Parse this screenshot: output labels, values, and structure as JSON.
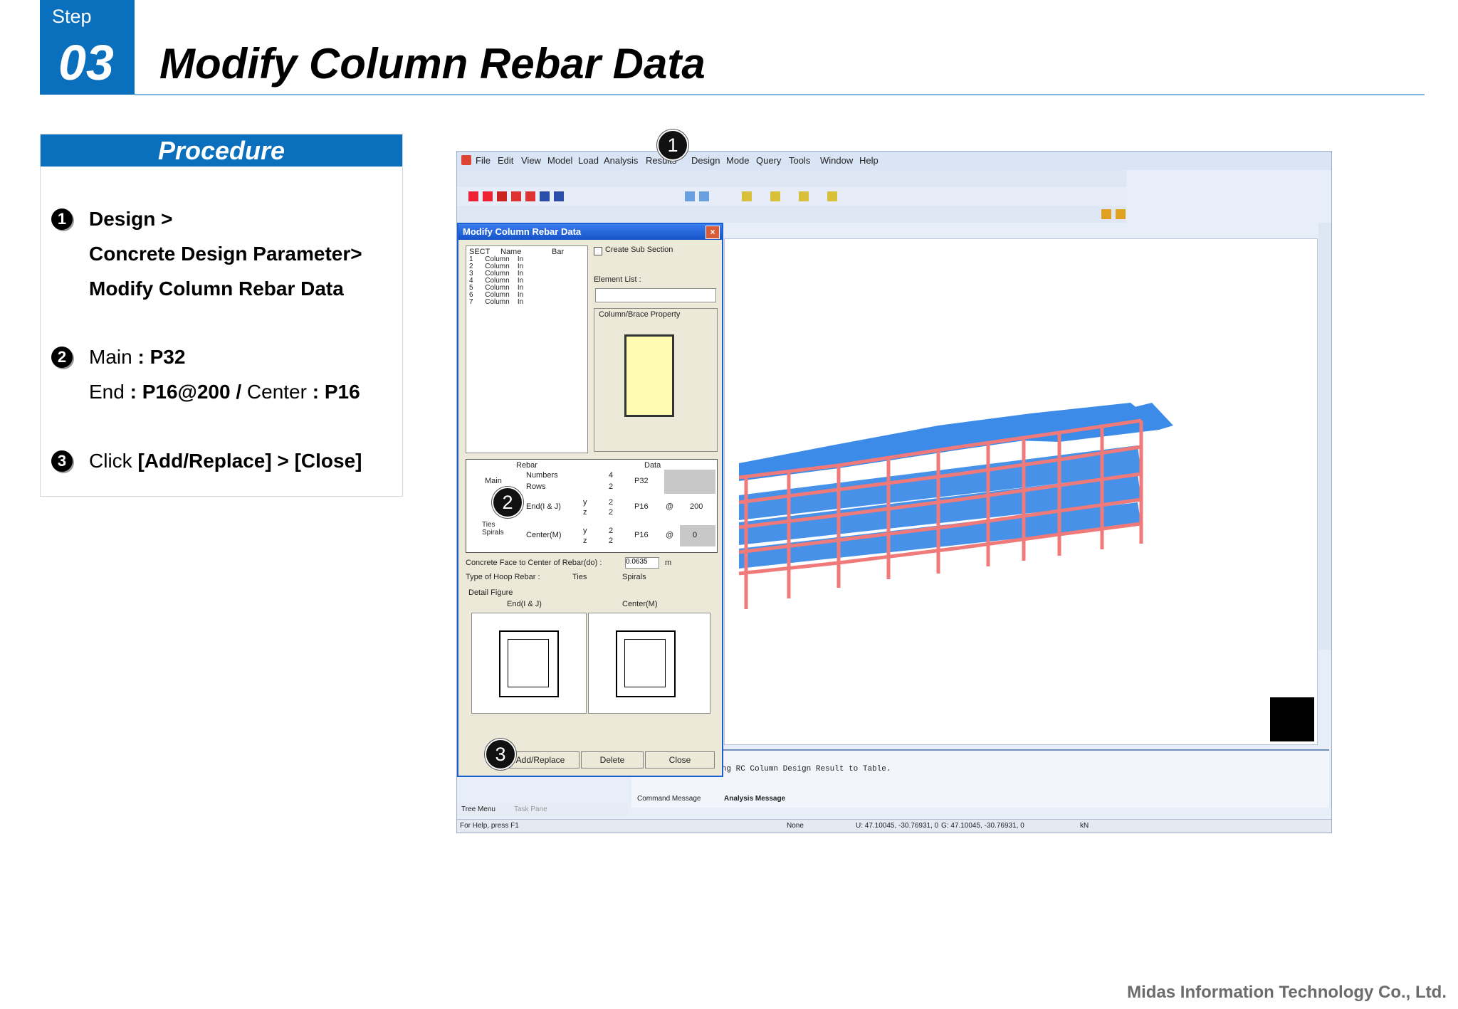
{
  "header": {
    "step_label": "Step",
    "step_number": "03",
    "title": "Modify Column Rebar Data"
  },
  "procedure": {
    "heading": "Procedure",
    "steps": [
      {
        "number": "1",
        "lines": [
          "Design >",
          "Concrete Design Parameter>",
          "Modify Column Rebar Data"
        ]
      },
      {
        "number": "2",
        "main_label": "Main",
        "main_value": ": P32",
        "end_label": "End",
        "end_value": ": P16@200",
        "sep": " / ",
        "center_label": "Center",
        "center_value": ": P16"
      },
      {
        "number": "3",
        "prefix": "Click ",
        "action": "[Add/Replace] > [Close]"
      }
    ]
  },
  "screenshot": {
    "menu": [
      "File",
      "Edit",
      "View",
      "Model",
      "Load",
      "Analysis",
      "Results",
      "Design",
      "Mode",
      "Query",
      "Tools",
      "Window",
      "Help"
    ],
    "dialog": {
      "title": "Modify Column Rebar Data",
      "close_glyph": "×",
      "list_headers": [
        "SECT",
        "Name",
        "Bar"
      ],
      "list_rows": [
        [
          "1",
          "Column",
          "In"
        ],
        [
          "2",
          "Column",
          "In"
        ],
        [
          "3",
          "Column",
          "In"
        ],
        [
          "4",
          "Column",
          "In"
        ],
        [
          "5",
          "Column",
          "In"
        ],
        [
          "6",
          "Column",
          "In"
        ],
        [
          "7",
          "Column",
          "In"
        ]
      ],
      "create_sub_section": "Create Sub Section",
      "element_list": "Element List :",
      "property_group": "Column/Brace Property",
      "table_header_rebar": "Rebar",
      "table_header_data": "Data",
      "main": "Main",
      "numbers": "Numbers",
      "numbers_value": "4",
      "rows": "Rows",
      "rows_value": "2",
      "main_bar": "P32",
      "ties_spirals": "Ties Spirals",
      "ends": "End(I & J)",
      "center": "Center(M)",
      "axis_y": "y",
      "axis_z": "z",
      "end_bar": "P16",
      "at": "@",
      "end_spacing": "200",
      "center_bar": "P16",
      "center_spacing": "0",
      "two": "2",
      "concrete_face": "Concrete Face to Center of Rebar(do) :",
      "concrete_face_value": "0.0635",
      "concrete_face_unit": "m",
      "hoop_type": "Type of Hoop Rebar :",
      "ties": "Ties",
      "spirals": "Spirals",
      "detail_figure": "Detail Figure",
      "fig_end": "End(I & J)",
      "fig_center": "Center(M)",
      "add_replace": "Add/Replace",
      "delete": "Delete",
      "close": "Close"
    },
    "message_line": "*** Finished Writing RC Column Design Result to Table.",
    "tabs": [
      "Tree Menu",
      "Task Pane",
      "Command Message",
      "Analysis Message"
    ],
    "status_help": "For Help, press F1",
    "status_none": "None",
    "status_coord": "U: 47.10045, -30.76931, 0",
    "status_coord2": "G: 47.10045, -30.76931, 0",
    "status_unit": "kN"
  },
  "callouts": [
    "1",
    "2",
    "3"
  ],
  "footer": "Midas Information Technology Co., Ltd.",
  "colors": {
    "brand_blue": "#0a6fbd",
    "model_slab": "#3d8be8",
    "model_frame": "#f07a7a"
  }
}
